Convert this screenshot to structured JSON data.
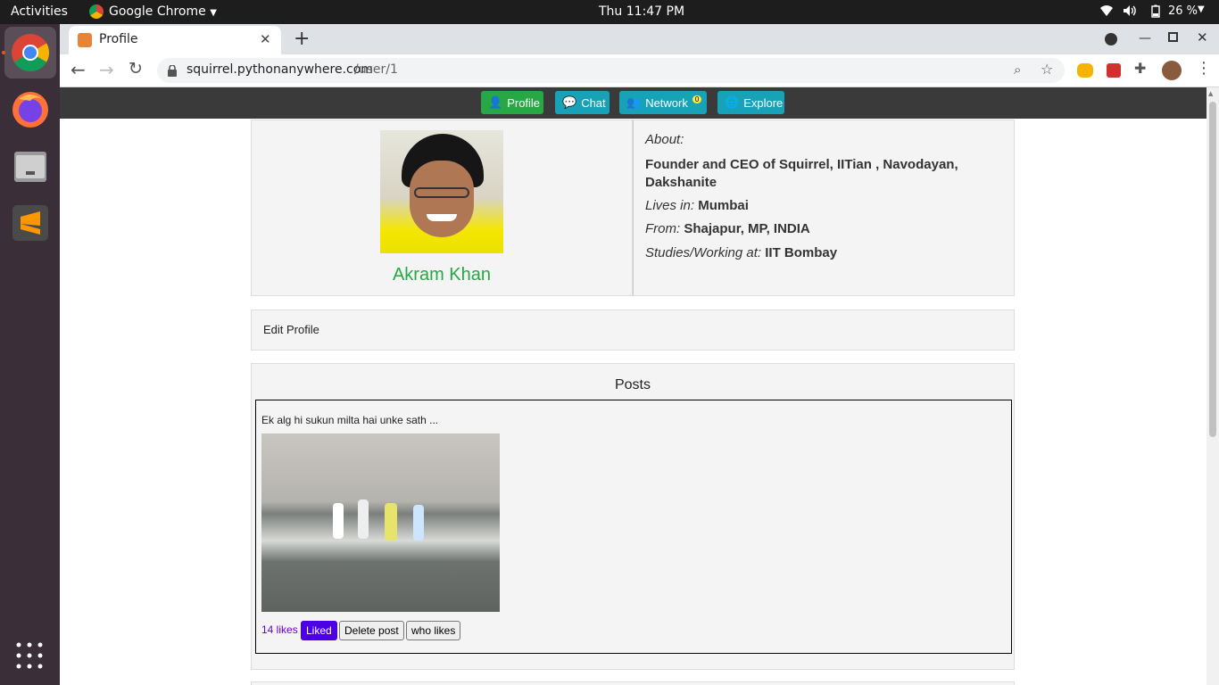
{
  "system": {
    "activities": "Activities",
    "app_name": "Google Chrome",
    "clock": "Thu 11:47 PM",
    "battery": "26 %"
  },
  "browser": {
    "tab_title": "Profile",
    "url_domain": "squirrel.pythonanywhere.com",
    "url_path": "/user/1"
  },
  "nav": {
    "profile": "Profile",
    "chat": "Chat",
    "network": "Network",
    "network_badge": "0",
    "explore": "Explore"
  },
  "profile": {
    "name": "Akram Khan",
    "about_label": "About:",
    "about_text": "Founder and CEO of Squirrel, IITian , Navodayan, Dakshanite",
    "lives_label": "Lives in:",
    "lives_value": "Mumbai",
    "from_label": "From:",
    "from_value": "Shajapur, MP, INDIA",
    "studies_label": "Studies/Working at:",
    "studies_value": "IIT Bombay"
  },
  "edit_profile": "Edit Profile",
  "posts": {
    "heading": "Posts",
    "items": [
      {
        "caption": "Ek alg hi sukun milta hai unke sath ...",
        "likes": "14 likes",
        "liked_label": "Liked",
        "delete_label": "Delete post",
        "who_likes_label": "who likes"
      }
    ]
  },
  "colors": {
    "profile_btn": "#28a745",
    "info_btn": "#17a2b8",
    "name": "#28a745",
    "liked": "#4b00e6",
    "likes_text": "#6a00d9"
  }
}
